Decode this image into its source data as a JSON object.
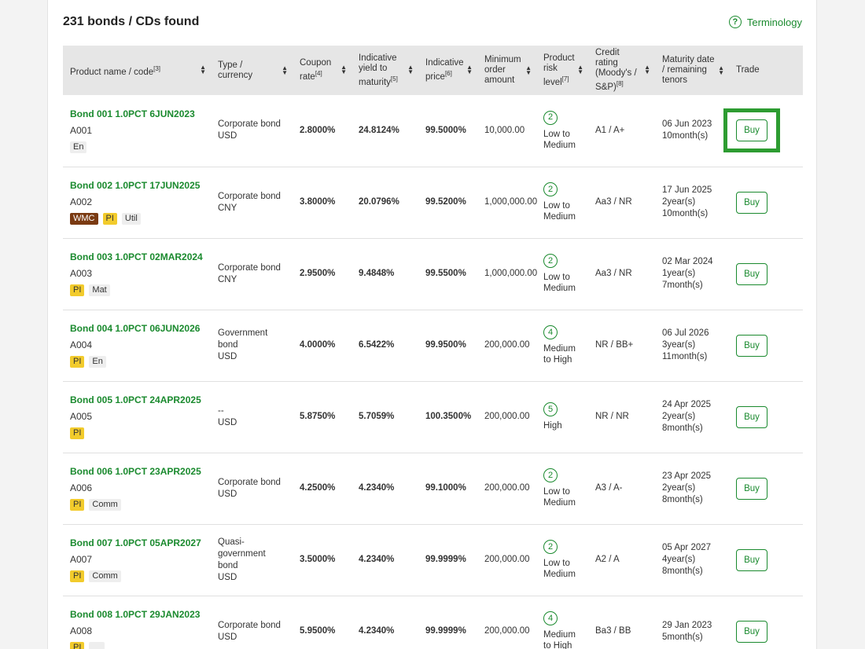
{
  "results": {
    "title": "231 bonds / CDs found",
    "terminology_label": "Terminology",
    "terminology_icon": "?"
  },
  "columns": [
    {
      "label": "Product name / code",
      "sup": "[3]",
      "sortable": true
    },
    {
      "label": "Type / currency",
      "sup": "",
      "sortable": true
    },
    {
      "label": "Coupon rate",
      "sup": "[4]",
      "sortable": true
    },
    {
      "label": "Indicative yield to maturity",
      "sup": "[5]",
      "sortable": true
    },
    {
      "label": "Indicative price",
      "sup": "[6]",
      "sortable": true
    },
    {
      "label": "Minimum order amount",
      "sup": "",
      "sortable": true
    },
    {
      "label": "Product risk level",
      "sup": "[7]",
      "sortable": true
    },
    {
      "label": "Credit rating (Moody's / S&P)",
      "sup": "[8]",
      "sortable": true
    },
    {
      "label": "Maturity date / remaining tenors",
      "sup": "",
      "sortable": true
    },
    {
      "label": "Trade",
      "sup": "",
      "sortable": false
    }
  ],
  "rows": [
    {
      "name": "Bond 001 1.0PCT 6JUN2023",
      "code": "A001",
      "tags": [
        "En"
      ],
      "type": "Corporate bond",
      "currency": "USD",
      "coupon": "2.8000%",
      "yield": "24.8124%",
      "price": "99.5000%",
      "min_order": "10,000.00",
      "risk_level": "2",
      "risk_label": "Low to Medium",
      "rating": "A1 / A+",
      "maturity": "06 Jun 2023",
      "tenor": "10month(s)",
      "buy": "Buy",
      "highlighted": true
    },
    {
      "name": "Bond 002 1.0PCT 17JUN2025",
      "code": "A002",
      "tags": [
        "WMC",
        "PI",
        "Util"
      ],
      "type": "Corporate bond",
      "currency": "CNY",
      "coupon": "3.8000%",
      "yield": "20.0796%",
      "price": "99.5200%",
      "min_order": "1,000,000.00",
      "risk_level": "2",
      "risk_label": "Low to Medium",
      "rating": "Aa3 / NR",
      "maturity": "17 Jun 2025",
      "tenor": "2year(s) 10month(s)",
      "buy": "Buy"
    },
    {
      "name": "Bond 003 1.0PCT 02MAR2024",
      "code": "A003",
      "tags": [
        "PI",
        "Mat"
      ],
      "type": "Corporate bond",
      "currency": "CNY",
      "coupon": "2.9500%",
      "yield": "9.4848%",
      "price": "99.5500%",
      "min_order": "1,000,000.00",
      "risk_level": "2",
      "risk_label": "Low to Medium",
      "rating": "Aa3 / NR",
      "maturity": "02 Mar 2024",
      "tenor": "1year(s) 7month(s)",
      "buy": "Buy"
    },
    {
      "name": "Bond 004 1.0PCT 06JUN2026",
      "code": "A004",
      "tags": [
        "PI",
        "En"
      ],
      "type": "Government bond",
      "currency": "USD",
      "coupon": "4.0000%",
      "yield": "6.5422%",
      "price": "99.9500%",
      "min_order": "200,000.00",
      "risk_level": "4",
      "risk_label": "Medium to High",
      "rating": "NR / BB+",
      "maturity": "06 Jul 2026",
      "tenor": "3year(s) 11month(s)",
      "buy": "Buy"
    },
    {
      "name": "Bond 005 1.0PCT 24APR2025",
      "code": "A005",
      "tags": [
        "PI"
      ],
      "type": "--",
      "currency": "USD",
      "coupon": "5.8750%",
      "yield": "5.7059%",
      "price": "100.3500%",
      "min_order": "200,000.00",
      "risk_level": "5",
      "risk_label": "High",
      "rating": "NR / NR",
      "maturity": "24 Apr 2025",
      "tenor": "2year(s) 8month(s)",
      "buy": "Buy"
    },
    {
      "name": "Bond 006 1.0PCT 23APR2025",
      "code": "A006",
      "tags": [
        "PI",
        "Comm"
      ],
      "type": "Corporate bond",
      "currency": "USD",
      "coupon": "4.2500%",
      "yield": "4.2340%",
      "price": "99.1000%",
      "min_order": "200,000.00",
      "risk_level": "2",
      "risk_label": "Low to Medium",
      "rating": "A3 / A-",
      "maturity": "23 Apr 2025",
      "tenor": "2year(s) 8month(s)",
      "buy": "Buy"
    },
    {
      "name": "Bond 007 1.0PCT 05APR2027",
      "code": "A007",
      "tags": [
        "PI",
        "Comm"
      ],
      "type": "Quasi-government bond",
      "currency": "USD",
      "coupon": "3.5000%",
      "yield": "4.2340%",
      "price": "99.9999%",
      "min_order": "200,000.00",
      "risk_level": "2",
      "risk_label": "Low to Medium",
      "rating": "A2 / A",
      "maturity": "05 Apr 2027",
      "tenor": "4year(s) 8month(s)",
      "buy": "Buy"
    },
    {
      "name": "Bond 008 1.0PCT 29JAN2023",
      "code": "A008",
      "tags": [
        "PI",
        ""
      ],
      "type": "Corporate bond",
      "currency": "USD",
      "coupon": "5.9500%",
      "yield": "4.2340%",
      "price": "99.9999%",
      "min_order": "200,000.00",
      "risk_level": "4",
      "risk_label": "Medium to High",
      "rating": "Ba3 / BB",
      "maturity": "29 Jan 2023",
      "tenor": "5month(s)",
      "buy": "Buy"
    }
  ],
  "colors": {
    "accent_green": "#1a8a2e",
    "highlight_green": "#2d9c31",
    "tag_pi": "#f2cb2c",
    "tag_wmc": "#7a3a12",
    "header_bg": "#e6e6e6"
  }
}
